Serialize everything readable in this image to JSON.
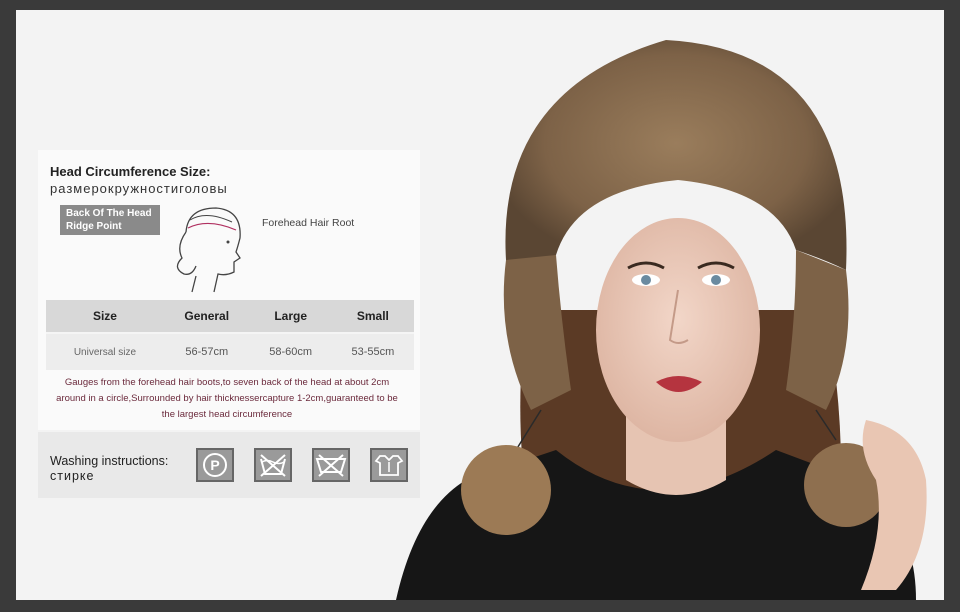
{
  "size_guide": {
    "title_en": "Head Circumference Size:",
    "title_ru": "размерокружностиголовы",
    "back_label": "Back Of The Head Ridge Point",
    "forehead_label": "Forehead Hair Root",
    "table": {
      "headers": [
        "Size",
        "General",
        "Large",
        "Small"
      ],
      "row": [
        "Universal size",
        "56-57cm",
        "58-60cm",
        "53-55cm"
      ]
    },
    "gauge_text": "Gauges from the forehead hair boots,to seven back of the head at about 2cm around in a circle,Surrounded by hair thicknessercapture 1-2cm,guaranteed to be the largest head circumference"
  },
  "washing": {
    "label_en": "Washing instructions:",
    "label_ru": "стирке",
    "icons": [
      "dry-clean-p-icon",
      "do-not-wash-icon",
      "do-not-bleach-icon",
      "tumble-dry-icon"
    ],
    "icon_p_letter": "P"
  },
  "colors": {
    "background": "#3a3a3a",
    "panel": "#fafafa",
    "table_header": "#d8d8d8",
    "gauge_text": "#6b2a3c",
    "fur": "#8a6e50"
  }
}
